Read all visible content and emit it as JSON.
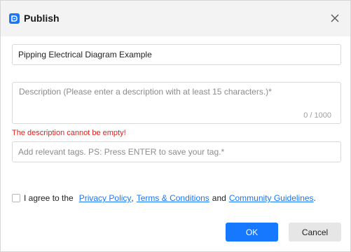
{
  "dialog": {
    "title": "Publish",
    "app_icon": "app-logo-icon",
    "close_icon": "close-icon"
  },
  "form": {
    "title_value": "Pipping Electrical Diagram Example",
    "description_placeholder": "Description (Please enter a description with at least 15 characters.)*",
    "description_value": "",
    "char_count": "0 / 1000",
    "error": "The description cannot be empty!",
    "tags_placeholder": "Add relevant tags. PS: Press ENTER to save your tag.*"
  },
  "agreement": {
    "prefix": "I agree to the",
    "privacy_policy": "Privacy Policy",
    "comma": ",",
    "terms": "Terms & Conditions",
    "and": "and",
    "community_guidelines": "Community Guidelines",
    "period": ".",
    "checked": false
  },
  "buttons": {
    "ok": "OK",
    "cancel": "Cancel"
  },
  "colors": {
    "accent": "#1677ff",
    "error": "#e0201c"
  }
}
